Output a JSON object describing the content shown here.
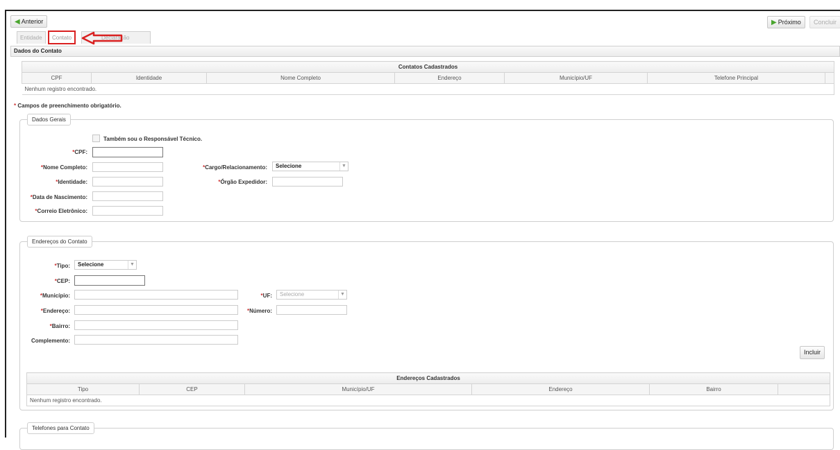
{
  "nav": {
    "prev": "Anterior",
    "next": "Próximo",
    "finish": "Concluir"
  },
  "tabs": [
    {
      "label": "Entidade"
    },
    {
      "label": "Contato"
    },
    {
      "label": "Declaração"
    }
  ],
  "panel_title": "Dados do Contato",
  "contacts_table": {
    "caption": "Contatos Cadastrados",
    "headers": [
      "CPF",
      "Identidade",
      "Nome Completo",
      "Endereço",
      "Município/UF",
      "Telefone Principal"
    ],
    "empty": "Nenhum registro encontrado."
  },
  "required_note": {
    "star": "*",
    "text": " Campos de preenchimento obrigatório."
  },
  "general": {
    "legend": "Dados Gerais",
    "checkbox_label": "Também sou o Responsável Técnico.",
    "cpf": "CPF:",
    "full_name": "Nome Completo:",
    "identity": "Identidade:",
    "birth_date": "Data de Nascimento:",
    "email": "Correio Eletrônico:",
    "role": "Cargo/Relacionamento:",
    "role_value": "Selecione",
    "issuer": "Órgão Expedidor:"
  },
  "address": {
    "legend": "Endereços do Contato",
    "type": "Tipo:",
    "type_value": "Selecione",
    "cep": "CEP:",
    "city": "Município:",
    "uf": "UF:",
    "uf_value": "Selecione",
    "street": "Endereço:",
    "number": "Número:",
    "district": "Bairro:",
    "complement": "Complemento:",
    "add_button": "Incluir"
  },
  "address_table": {
    "caption": "Endereços Cadastrados",
    "headers": [
      "Tipo",
      "CEP",
      "Município/UF",
      "Endereço",
      "Bairro"
    ],
    "empty": "Nenhum registro encontrado."
  },
  "phones": {
    "legend": "Telefones para Contato"
  },
  "star": "*",
  "colors": {
    "annotation": "#d92020",
    "required": "#cc3333",
    "nav_arrow": "#4aa52e"
  }
}
